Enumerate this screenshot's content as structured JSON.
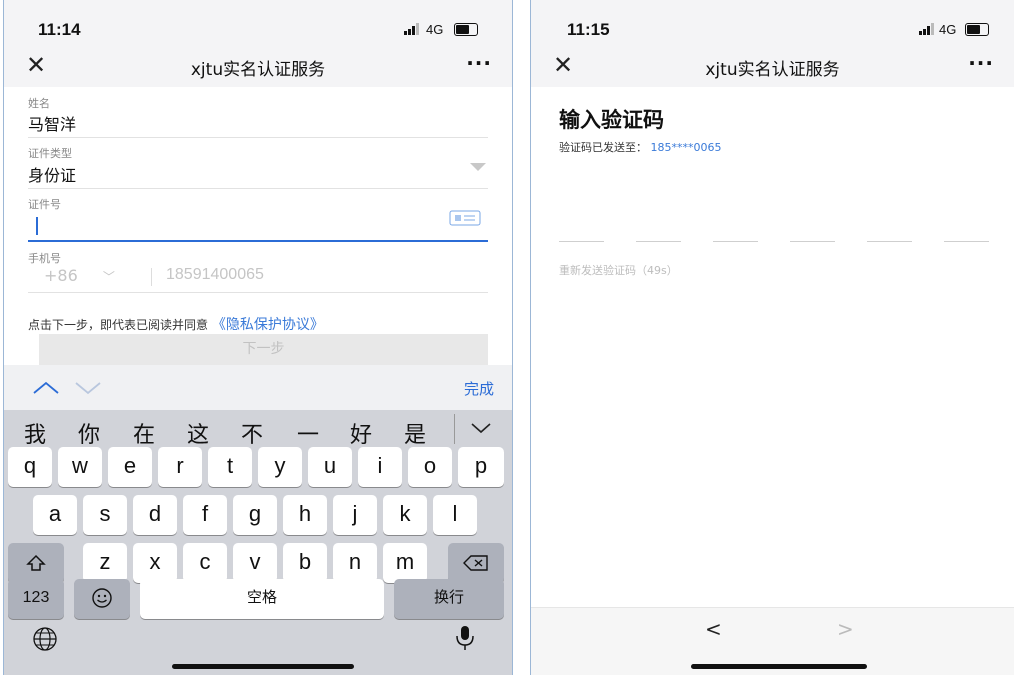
{
  "left": {
    "status": {
      "time": "11:14",
      "network": "4G"
    },
    "nav": {
      "close": "✕",
      "title": "xjtu实名认证服务",
      "more": "···"
    },
    "form": {
      "name_label": "姓名",
      "name_value": "马智洋",
      "idtype_label": "证件类型",
      "idtype_value": "身份证",
      "idnum_label": "证件号",
      "idnum_value": "",
      "phone_label": "手机号",
      "country_code": "+86",
      "phone_value": "18591400065",
      "agree_text": "点击下一步，即代表已阅读并同意",
      "privacy_link": "《隐私保护协议》",
      "next_button": "下一步"
    },
    "kb_toolbar": {
      "done": "完成"
    },
    "candidates": [
      "我",
      "你",
      "在",
      "这",
      "不",
      "一",
      "好",
      "是"
    ],
    "keys": {
      "row1": [
        "q",
        "w",
        "e",
        "r",
        "t",
        "y",
        "u",
        "i",
        "o",
        "p"
      ],
      "row2": [
        "a",
        "s",
        "d",
        "f",
        "g",
        "h",
        "j",
        "k",
        "l"
      ],
      "row3": [
        "z",
        "x",
        "c",
        "v",
        "b",
        "n",
        "m"
      ],
      "num": "123",
      "space": "空格",
      "return": "换行"
    }
  },
  "right": {
    "status": {
      "time": "11:15",
      "network": "4G"
    },
    "nav": {
      "close": "✕",
      "title": "xjtu实名认证服务",
      "more": "···"
    },
    "heading": "输入验证码",
    "sent_label": "验证码已发送至：",
    "sent_phone": "185****0065",
    "resend": "重新发送验证码（49s）",
    "back_arrow": "<",
    "forward_arrow": ">"
  },
  "colors": {
    "accent": "#2b6cd6",
    "link": "#3a7ad8",
    "disabled": "#e8e8e8",
    "keyboard_bg": "#d1d3d9"
  }
}
